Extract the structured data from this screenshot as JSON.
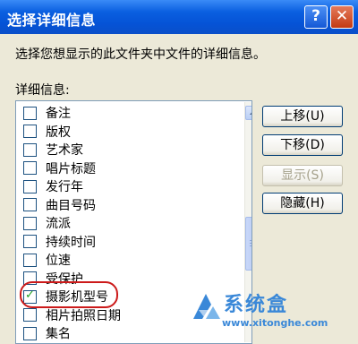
{
  "dialog": {
    "title": "选择详细信息",
    "help_glyph": "?",
    "close_glyph": "✕",
    "instruction": "选择您想显示的此文件夹中文件的详细信息。",
    "details_label": "详细信息:"
  },
  "list": {
    "items": [
      {
        "label": "备注",
        "checked": false
      },
      {
        "label": "版权",
        "checked": false
      },
      {
        "label": "艺术家",
        "checked": false
      },
      {
        "label": "唱片标题",
        "checked": false
      },
      {
        "label": "发行年",
        "checked": false
      },
      {
        "label": "曲目号码",
        "checked": false
      },
      {
        "label": "流派",
        "checked": false
      },
      {
        "label": "持续时间",
        "checked": false
      },
      {
        "label": "位速",
        "checked": false
      },
      {
        "label": "受保护",
        "checked": false
      },
      {
        "label": "摄影机型号",
        "checked": true
      },
      {
        "label": "相片拍照日期",
        "checked": false
      },
      {
        "label": "集名",
        "checked": false
      }
    ]
  },
  "buttons": {
    "move_up": "上移(U)",
    "move_down": "下移(D)",
    "show": "显示(S)",
    "hide": "隐藏(H)"
  },
  "watermark": {
    "brand": "系统盒",
    "url": "www.xitonghe.com"
  },
  "colors": {
    "titlebar": "#0a5fe0",
    "highlight": "#cc1a1a",
    "watermark": "#3a88d8"
  }
}
